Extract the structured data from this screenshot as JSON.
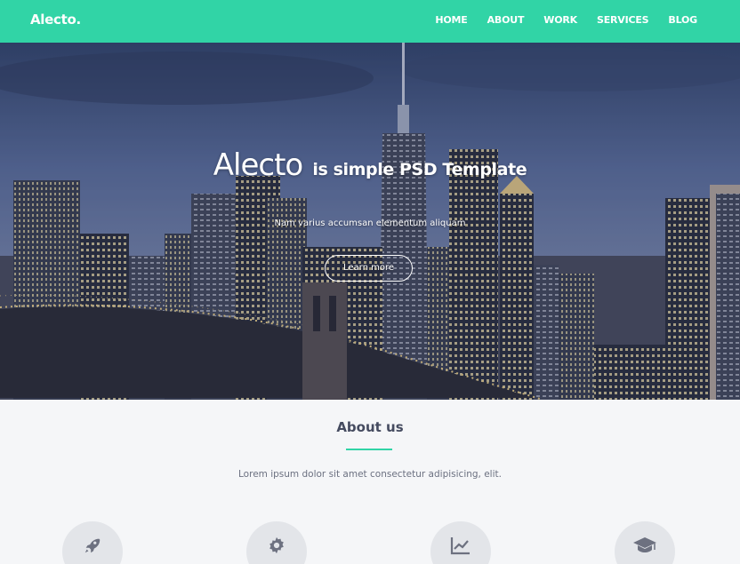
{
  "navbar": {
    "logo": "Alecto.",
    "links": [
      "HOME",
      "ABOUT",
      "WORK",
      "SERVICES",
      "BLOG"
    ]
  },
  "hero": {
    "title_big": "Alecto",
    "title_small": "is simple PSD Template",
    "subtitle": "Nam varius accumsan elementum aliquam",
    "button": "Learn more"
  },
  "about": {
    "title": "About us",
    "text": "Lorem ipsum dolor sit amet consectetur adipisicing, elit.",
    "features": [
      {
        "icon": "rocket-icon"
      },
      {
        "icon": "gear-icon"
      },
      {
        "icon": "chart-line-icon"
      },
      {
        "icon": "graduation-cap-icon"
      }
    ]
  },
  "colors": {
    "accent": "#31d4a6",
    "heading": "#454b60",
    "body_text": "#6b7080",
    "background": "#f5f6f8"
  }
}
